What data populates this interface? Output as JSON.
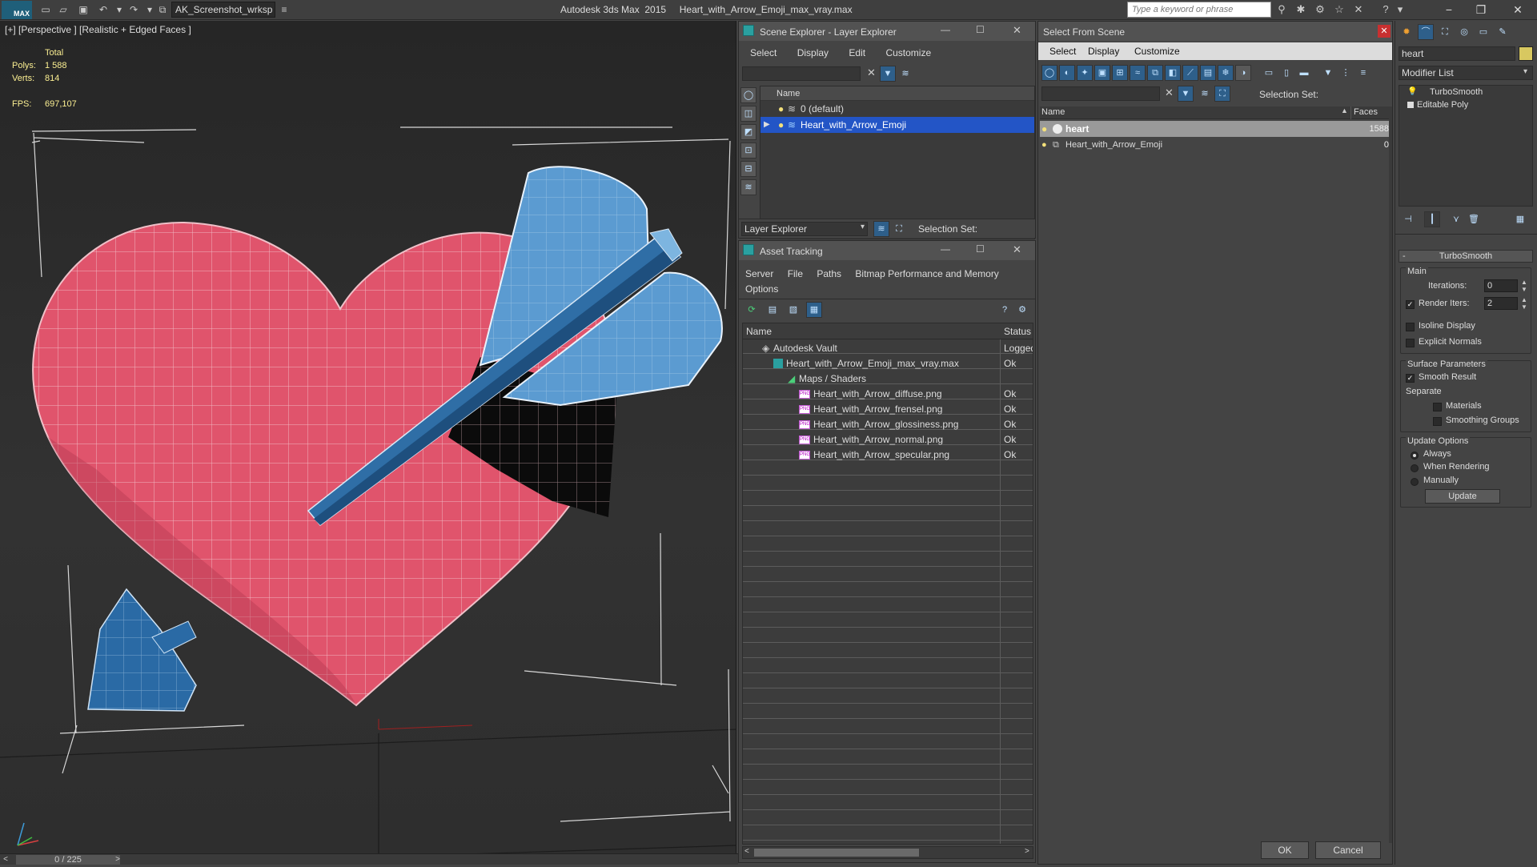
{
  "app": {
    "logo": "MAX",
    "workspace": "AK_Screenshot_wrksp",
    "title": "Autodesk 3ds Max  2015     Heart_with_Arrow_Emoji_max_vray.max",
    "search_placeholder": "Type a keyword or phrase"
  },
  "viewport": {
    "label": "[+] [Perspective ] [Realistic + Edged Faces ]",
    "stats": {
      "total_label": "Total",
      "polys_label": "Polys:",
      "polys": "1 588",
      "verts_label": "Verts:",
      "verts": "814",
      "fps_label": "FPS:",
      "fps": "697,107"
    },
    "colors": {
      "heart": "#e0546c",
      "arrow": "#3f7fb8",
      "background": "#2d2d2d"
    },
    "frame_counter": "0 / 225"
  },
  "scene_explorer": {
    "title": "Scene Explorer - Layer Explorer",
    "menu": [
      "Select",
      "Display",
      "Edit",
      "Customize"
    ],
    "col_name": "Name",
    "rows": [
      {
        "label": "0 (default)"
      },
      {
        "label": "Heart_with_Arrow_Emoji",
        "selected": true
      }
    ],
    "footer_dropdown": "Layer Explorer",
    "selection_set_label": "Selection Set:"
  },
  "asset_tracking": {
    "title": "Asset Tracking",
    "menu": [
      "Server",
      "File",
      "Paths",
      "Bitmap Performance and Memory"
    ],
    "menu2": "Options",
    "col_name": "Name",
    "col_status": "Status",
    "rows": [
      {
        "name": "Autodesk Vault",
        "status": "Logged",
        "level": 1
      },
      {
        "name": "Heart_with_Arrow_Emoji_max_vray.max",
        "status": "Ok",
        "level": 2
      },
      {
        "name": "Maps / Shaders",
        "status": "",
        "level": 3
      },
      {
        "name": "Heart_with_Arrow_diffuse.png",
        "status": "Ok",
        "level": 4
      },
      {
        "name": "Heart_with_Arrow_frensel.png",
        "status": "Ok",
        "level": 4
      },
      {
        "name": "Heart_with_Arrow_glossiness.png",
        "status": "Ok",
        "level": 4
      },
      {
        "name": "Heart_with_Arrow_normal.png",
        "status": "Ok",
        "level": 4
      },
      {
        "name": "Heart_with_Arrow_specular.png",
        "status": "Ok",
        "level": 4
      }
    ],
    "png_badge": "PNG"
  },
  "select_from_scene": {
    "title": "Select From Scene",
    "menu": [
      "Select",
      "Display",
      "Customize"
    ],
    "selection_set_label": "Selection Set:",
    "col_name": "Name",
    "col_faces": "Faces",
    "rows": [
      {
        "name": "heart",
        "faces": "1588",
        "selected": true
      },
      {
        "name": "Heart_with_Arrow_Emoji",
        "faces": "0"
      }
    ],
    "ok": "OK",
    "cancel": "Cancel"
  },
  "modify_panel": {
    "name_value": "heart",
    "modifier_list": "Modifier List",
    "stack": [
      "TurboSmooth",
      "Editable Poly"
    ],
    "rollout_title": "TurboSmooth",
    "main_label": "Main",
    "iterations_label": "Iterations:",
    "iterations": "0",
    "render_iters_label": "Render Iters:",
    "render_iters": "2",
    "render_iters_checked": true,
    "isoline_label": "Isoline Display",
    "explicit_label": "Explicit Normals",
    "surface_label": "Surface Parameters",
    "smooth_label": "Smooth Result",
    "smooth_checked": true,
    "separate_label": "Separate",
    "materials_label": "Materials",
    "smoothing_label": "Smoothing Groups",
    "update_options_label": "Update Options",
    "always_label": "Always",
    "when_rendering_label": "When Rendering",
    "manually_label": "Manually",
    "update_button": "Update"
  }
}
